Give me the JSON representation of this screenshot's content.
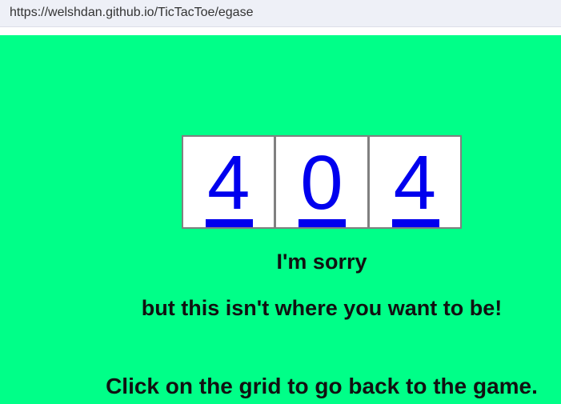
{
  "browser": {
    "url": "https://welshdan.github.io/TicTacToe/egase"
  },
  "colors": {
    "background": "#00ff88",
    "link": "#0000ee",
    "text": "#111111"
  },
  "grid": {
    "cells": [
      "4",
      "0",
      "4"
    ]
  },
  "messages": {
    "sorry": "I'm sorry",
    "not_here": "but this isn't where you want to be!",
    "instruction": "Click on the grid to go back to the game."
  }
}
